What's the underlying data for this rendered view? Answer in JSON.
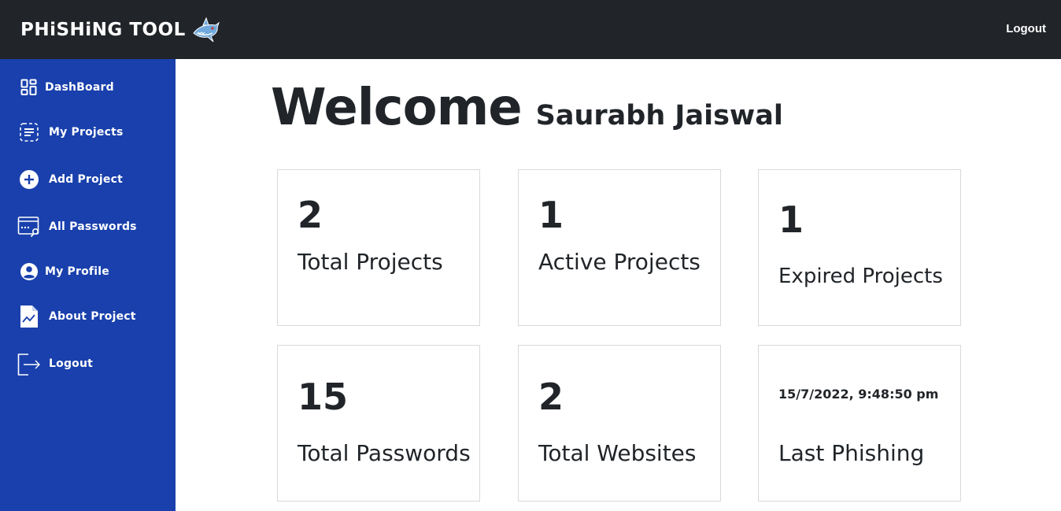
{
  "header": {
    "brand": "PHiSHiNG TOOL",
    "logo_icon": "shark-icon",
    "logout_label": "Logout"
  },
  "sidebar": {
    "items": [
      {
        "label": "DashBoard",
        "icon": "dashboard-grid-icon"
      },
      {
        "label": "My Projects",
        "icon": "list-icon"
      },
      {
        "label": "Add Project",
        "icon": "plus-circle-icon"
      },
      {
        "label": "All Passwords",
        "icon": "password-window-icon"
      },
      {
        "label": "My Profile",
        "icon": "user-circle-icon"
      },
      {
        "label": "About Project",
        "icon": "chart-document-icon"
      },
      {
        "label": "Logout",
        "icon": "logout-icon"
      }
    ]
  },
  "main": {
    "welcome": "Welcome",
    "user_name": "Saurabh Jaiswal",
    "cards": [
      {
        "value": "2",
        "label": "Total Projects"
      },
      {
        "value": "1",
        "label": "Active Projects"
      },
      {
        "value": "1",
        "label": "Expired Projects"
      },
      {
        "value": "15",
        "label": "Total Passwords"
      },
      {
        "value": "2",
        "label": "Total Websites"
      },
      {
        "value": "15/7/2022, 9:48:50 pm",
        "label": "Last Phishing"
      }
    ]
  },
  "colors": {
    "topbar": "#212429",
    "sidebar": "#1940ac",
    "text": "#212529",
    "card_border": "#d9d9d9"
  }
}
